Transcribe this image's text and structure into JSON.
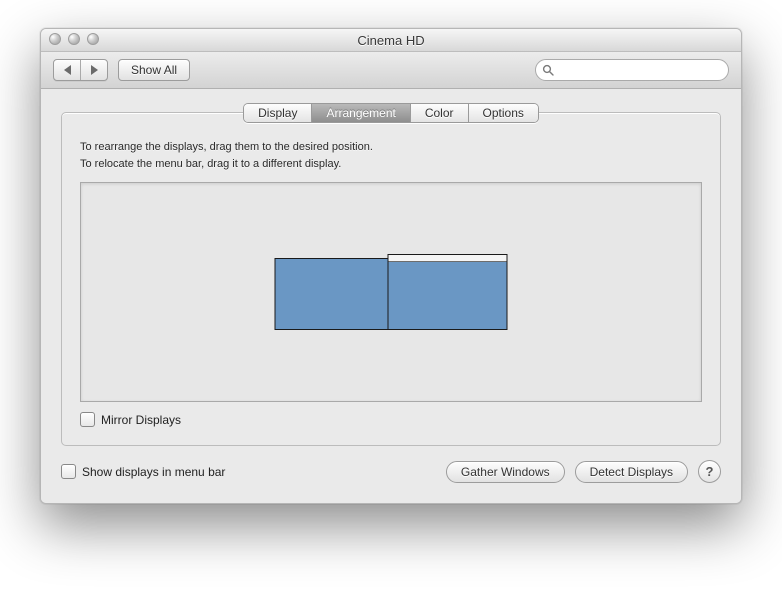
{
  "window": {
    "title": "Cinema HD"
  },
  "toolbar": {
    "show_all": "Show All",
    "search_placeholder": ""
  },
  "tabs": {
    "display": "Display",
    "arrangement": "Arrangement",
    "color": "Color",
    "options": "Options",
    "active": "arrangement"
  },
  "panel": {
    "instr1": "To rearrange the displays, drag them to the desired position.",
    "instr2": "To relocate the menu bar, drag it to a different display.",
    "mirror_label": "Mirror Displays",
    "mirror_checked": false,
    "displays": [
      {
        "id": "display-1",
        "menubar": false
      },
      {
        "id": "display-2",
        "menubar": true
      }
    ]
  },
  "footer": {
    "show_in_menubar_label": "Show displays in menu bar",
    "show_in_menubar_checked": false,
    "gather": "Gather Windows",
    "detect": "Detect Displays"
  }
}
